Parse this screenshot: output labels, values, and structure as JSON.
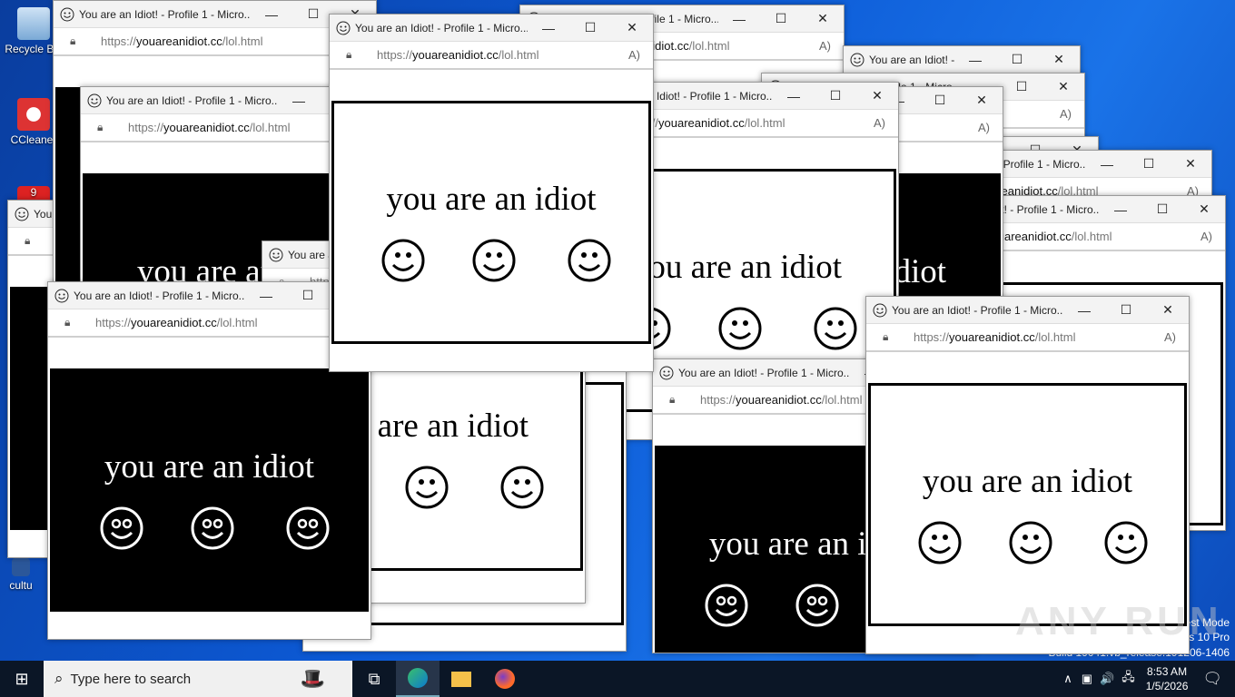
{
  "desktop": {
    "icons": [
      {
        "label": "Recycle Bin"
      },
      {
        "label": "CCleaner"
      },
      {
        "label": "9"
      },
      {
        "label": "cultu"
      }
    ]
  },
  "watermark": {
    "line1": "Test Mode",
    "line2": "Windows 10 Pro",
    "line3": "Build 19041.vb_release.191206-1406",
    "brand": "ANY RUN"
  },
  "window": {
    "title": "You are an Idiot! - Profile 1 - Micro...",
    "url_scheme": "https://",
    "url_host": "youareanidiot.cc",
    "url_path": "/lol.html",
    "message": "you are an idiot"
  },
  "taskbar": {
    "search_placeholder": "Type here to search",
    "time": "8:53 AM",
    "date": "1/5/2026"
  },
  "colors": {
    "desktop": "#0c5ad6",
    "taskbar": "#0b1626"
  }
}
